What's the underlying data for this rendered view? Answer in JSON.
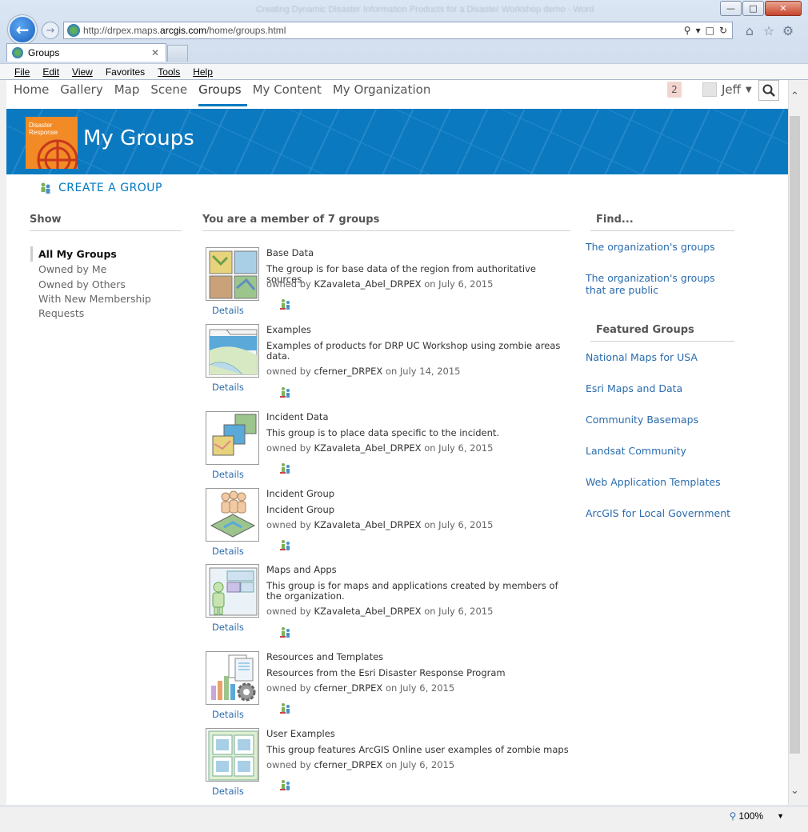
{
  "browser": {
    "window_title": "Creating Dynamic Disaster Information Products for a Disaster Workshop demo - Word",
    "url_prefix": "http://drpex.maps.",
    "url_domain": "arcgis.com",
    "url_path": "/home/groups.html",
    "tab_title": "Groups",
    "menu": [
      "File",
      "Edit",
      "View",
      "Favorites",
      "Tools",
      "Help"
    ],
    "zoom": "100%"
  },
  "nav": {
    "items": [
      "Home",
      "Gallery",
      "Map",
      "Scene",
      "Groups",
      "My Content",
      "My Organization"
    ],
    "active": "Groups",
    "notifications": "2",
    "user": "Jeff"
  },
  "banner": {
    "logo_text_line1": "Disaster",
    "logo_text_line2": "Response",
    "title": "My Groups"
  },
  "create_group": "CREATE A GROUP",
  "show": {
    "heading": "Show",
    "items": [
      {
        "label": "All My Groups",
        "selected": true
      },
      {
        "label": "Owned by Me",
        "selected": false
      },
      {
        "label": "Owned by Others",
        "selected": false
      },
      {
        "label": "With New Membership Requests",
        "selected": false
      }
    ]
  },
  "groups_heading": "You are a member of 7 groups",
  "groups": [
    {
      "title": "Base Data",
      "desc": "The group is for base data of the region from authoritative sources.",
      "owned_by": "owned by",
      "owner": "KZavaleta_Abel_DRPEX",
      "date": "on July 6, 2015",
      "details": "Details"
    },
    {
      "title": "Examples",
      "desc": "Examples of products for DRP UC Workshop using zombie areas data.",
      "owned_by": "owned by",
      "owner": "cferner_DRPEX",
      "date": "on July 14, 2015",
      "details": "Details"
    },
    {
      "title": "Incident Data",
      "desc": "This group is to place data specific to the incident.",
      "owned_by": "owned by",
      "owner": "KZavaleta_Abel_DRPEX",
      "date": "on July 6, 2015",
      "details": "Details"
    },
    {
      "title": "Incident Group",
      "desc": "Incident Group",
      "owned_by": "owned by",
      "owner": "KZavaleta_Abel_DRPEX",
      "date": "on July 6, 2015",
      "details": "Details"
    },
    {
      "title": "Maps and Apps",
      "desc": "This group is for maps and applications created by members of the organization.",
      "owned_by": "owned by",
      "owner": "KZavaleta_Abel_DRPEX",
      "date": "on July 6, 2015",
      "details": "Details"
    },
    {
      "title": "Resources and Templates",
      "desc": "Resources from the Esri Disaster Response Program",
      "owned_by": "owned by",
      "owner": "cferner_DRPEX",
      "date": "on July 6, 2015",
      "details": "Details"
    },
    {
      "title": "User Examples",
      "desc": "This group features ArcGIS Online user examples of zombie maps",
      "owned_by": "owned by",
      "owner": "cferner_DRPEX",
      "date": "on July 6, 2015",
      "details": "Details"
    }
  ],
  "find": {
    "heading": "Find...",
    "links": [
      "The organization's groups",
      "The organization's groups that are public"
    ]
  },
  "featured": {
    "heading": "Featured Groups",
    "links": [
      "National Maps for USA",
      "Esri Maps and Data",
      "Community Basemaps",
      "Landsat Community",
      "Web Application Templates",
      "ArcGIS for Local Government"
    ]
  },
  "colors": {
    "accent": "#0079c1",
    "link": "#2b6cae",
    "logo": "#f28a25"
  }
}
